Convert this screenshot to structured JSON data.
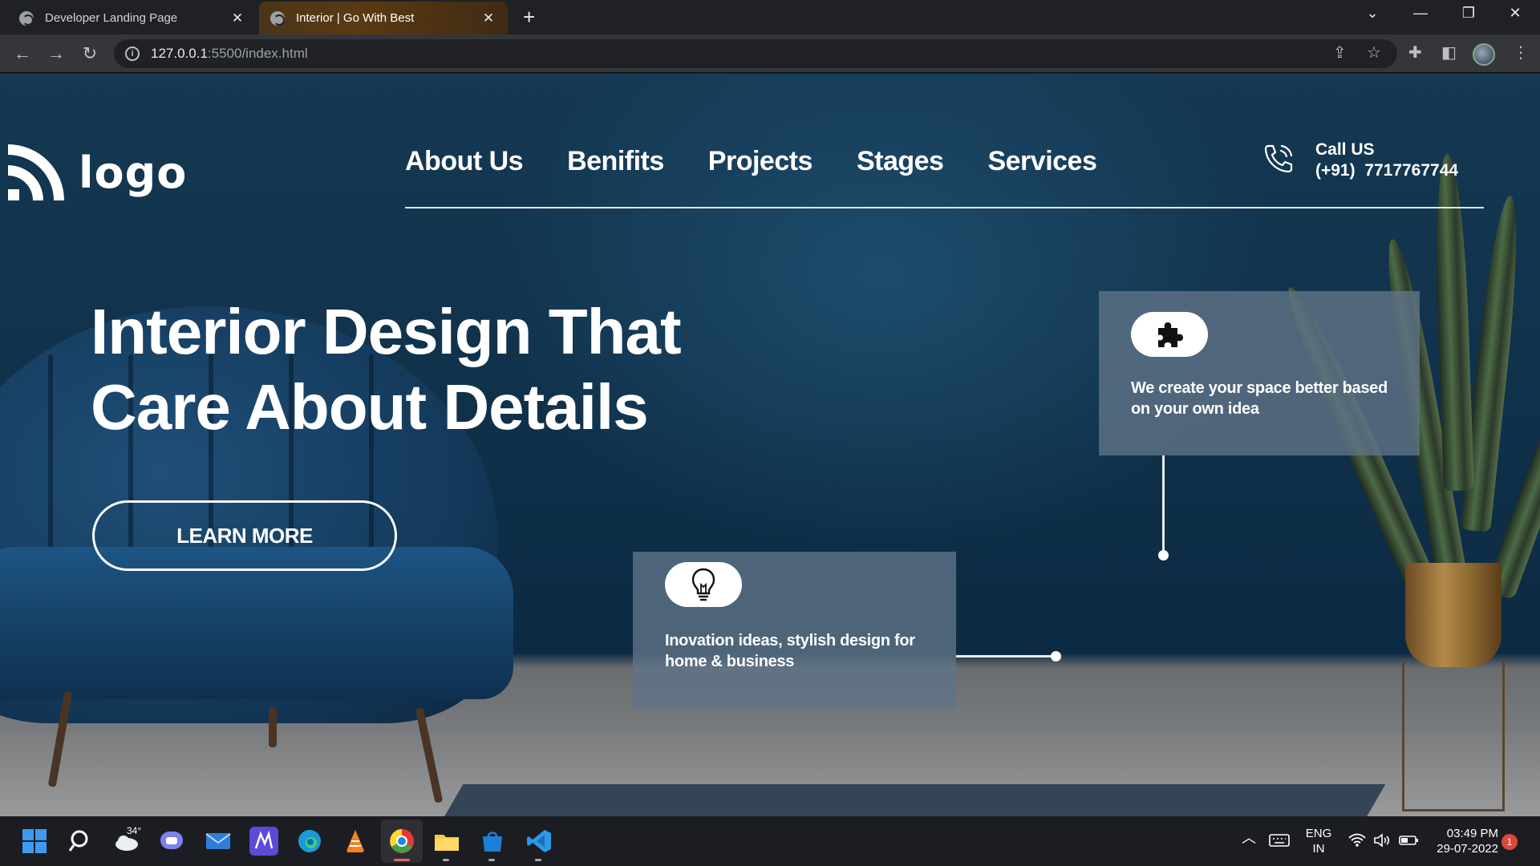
{
  "browser": {
    "tabs": [
      {
        "title": "Developer Landing Page",
        "active": false
      },
      {
        "title": "Interior | Go With Best",
        "active": true
      }
    ],
    "new_tab_label": "+",
    "url_host": "127.0.0.1",
    "url_path": ":5500/index.html"
  },
  "site": {
    "logo_text": "logo",
    "nav": [
      "About Us",
      "Benifits",
      "Projects",
      "Stages",
      "Services"
    ],
    "call_label": "Call US",
    "call_number": "(+91)  7717767744",
    "hero_line1": "Interior Design That",
    "hero_line2": "Care About Details",
    "cta_label": "LEARN MORE",
    "card1_text": "We create your space better based on your own idea",
    "card2_text": "Inovation ideas, stylish design for home & business"
  },
  "taskbar": {
    "weather_temp": "34°",
    "lang_line1": "ENG",
    "lang_line2": "IN",
    "time": "03:49 PM",
    "date": "29-07-2022",
    "notification_count": "1"
  },
  "colors": {
    "page_bg": "#153953",
    "card_bg": "#5f7387",
    "accent_white": "#ffffff"
  }
}
